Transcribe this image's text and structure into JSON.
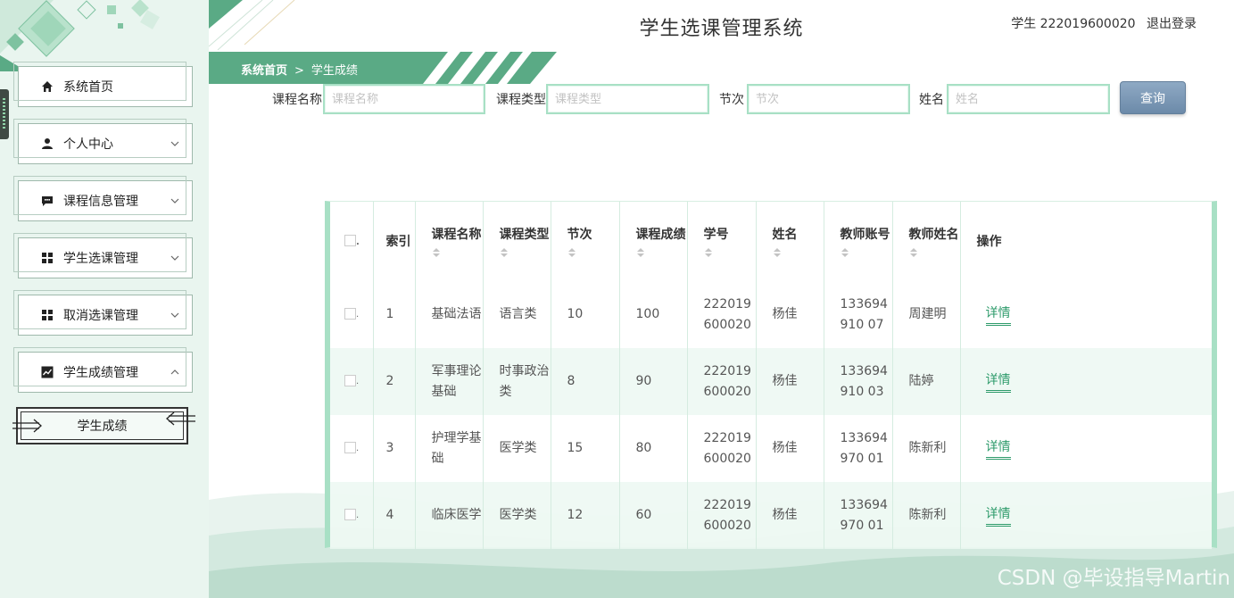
{
  "app": {
    "title": "学生选课管理系统"
  },
  "user": {
    "info": "学生 222019600020",
    "logout": "退出登录"
  },
  "breadcrumb": {
    "home": "系统首页",
    "separator": ">",
    "current": "学生成绩"
  },
  "sidebar": {
    "items": [
      {
        "label": "系统首页",
        "icon": "home-icon"
      },
      {
        "label": "个人中心",
        "icon": "user-icon"
      },
      {
        "label": "课程信息管理",
        "icon": "message-icon"
      },
      {
        "label": "学生选课管理",
        "icon": "grid-icon"
      },
      {
        "label": "取消选课管理",
        "icon": "grid-icon"
      },
      {
        "label": "学生成绩管理",
        "icon": "chart-icon"
      }
    ],
    "sub_item": "学生成绩"
  },
  "search": {
    "course_name_label": "课程名称",
    "course_name_placeholder": "课程名称",
    "course_type_label": "课程类型",
    "course_type_placeholder": "课程类型",
    "section_label": "节次",
    "section_placeholder": "节次",
    "name_label": "姓名",
    "name_placeholder": "姓名",
    "button": "查询"
  },
  "table": {
    "headers": {
      "index": "索引",
      "course_name": "课程名称",
      "course_type": "课程类型",
      "section": "节次",
      "score": "课程成绩",
      "student_no": "学号",
      "name": "姓名",
      "teacher_account": "教师账号",
      "teacher_name": "教师姓名",
      "action": "操作"
    },
    "rows": [
      {
        "index": "1",
        "course_name": "基础法语",
        "course_type": "语言类",
        "section": "10",
        "score": "100",
        "student_no": "222019600020",
        "name": "杨佳",
        "teacher_account": "133694910 07",
        "teacher_name": "周建明",
        "action": "详情"
      },
      {
        "index": "2",
        "course_name": "军事理论基础",
        "course_type": "时事政治类",
        "section": "8",
        "score": "90",
        "student_no": "222019600020",
        "name": "杨佳",
        "teacher_account": "133694910 03",
        "teacher_name": "陆婷",
        "action": "详情"
      },
      {
        "index": "3",
        "course_name": "护理学基础",
        "course_type": "医学类",
        "section": "15",
        "score": "80",
        "student_no": "222019600020",
        "name": "杨佳",
        "teacher_account": "133694970 01",
        "teacher_name": "陈新利",
        "action": "详情"
      },
      {
        "index": "4",
        "course_name": "临床医学",
        "course_type": "医学类",
        "section": "12",
        "score": "60",
        "student_no": "222019600020",
        "name": "杨佳",
        "teacher_account": "133694970 01",
        "teacher_name": "陈新利",
        "action": "详情"
      }
    ]
  },
  "watermark": "CSDN @毕设指导Martin",
  "colors": {
    "accent": "#5aaa85",
    "accent_light": "#a8e0c5",
    "sidebar_bg": "#e9f5ef",
    "button": "#7a96b3"
  }
}
